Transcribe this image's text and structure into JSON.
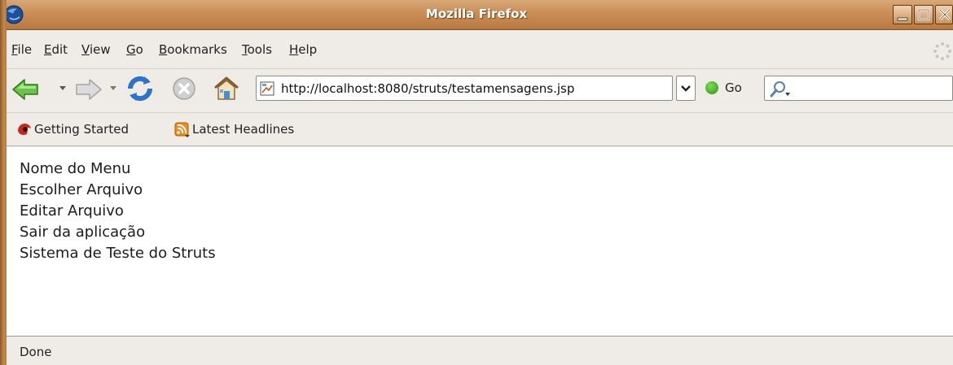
{
  "window": {
    "title": "Mozilla Firefox"
  },
  "menubar": {
    "items": [
      {
        "label": "File",
        "accel": "F"
      },
      {
        "label": "Edit",
        "accel": "E"
      },
      {
        "label": "View",
        "accel": "V"
      },
      {
        "label": "Go",
        "accel": "G"
      },
      {
        "label": "Bookmarks",
        "accel": "B"
      },
      {
        "label": "Tools",
        "accel": "T"
      },
      {
        "label": "Help",
        "accel": "H"
      }
    ]
  },
  "toolbar": {
    "back_icon": "back-arrow-icon",
    "forward_icon": "forward-arrow-icon",
    "reload_icon": "reload-icon",
    "stop_icon": "stop-icon",
    "home_icon": "home-icon",
    "url": "http://localhost:8080/struts/testamensagens.jsp",
    "go_label": "Go",
    "search_value": ""
  },
  "bookmarks": {
    "items": [
      {
        "label": "Getting Started",
        "icon": "firefox-logo-icon"
      },
      {
        "label": "Latest Headlines",
        "icon": "rss-feed-icon"
      }
    ]
  },
  "content": {
    "lines": [
      "Nome do Menu",
      "Escolher Arquivo",
      "Editar Arquivo",
      "Sair da aplicação",
      "Sistema de Teste do Struts"
    ]
  },
  "status": {
    "text": "Done"
  },
  "colors": {
    "titlebar": "#c98d55",
    "chrome": "#efebe7",
    "content_bg": "#ffffff"
  }
}
